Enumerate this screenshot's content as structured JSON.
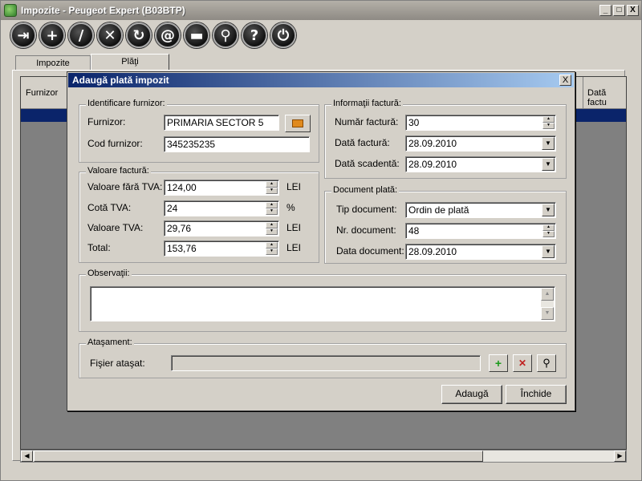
{
  "window": {
    "title": "Impozite - Peugeot Expert (B03BTP)",
    "min": "_",
    "max": "□",
    "close": "X"
  },
  "toolbar": [
    {
      "icon": "exit-icon",
      "glyph": "⇥"
    },
    {
      "icon": "add-icon",
      "glyph": "+"
    },
    {
      "icon": "edit-icon",
      "glyph": "/"
    },
    {
      "icon": "delete-icon",
      "glyph": "✕"
    },
    {
      "icon": "refresh-icon",
      "glyph": "↻"
    },
    {
      "icon": "email-icon",
      "glyph": "@"
    },
    {
      "icon": "print-icon",
      "glyph": "▬"
    },
    {
      "icon": "search-icon",
      "glyph": "⚲"
    },
    {
      "icon": "help-icon",
      "glyph": "?"
    },
    {
      "icon": "power-icon",
      "glyph": "⏻"
    }
  ],
  "tabs": [
    "Impozite",
    "Plăţi"
  ],
  "grid": {
    "col_left": "Furnizor",
    "col_right": "Dată factu"
  },
  "dialog": {
    "title": "Adaugă plată impozit",
    "close": "X",
    "identificare": {
      "title": "Identificare furnizor:",
      "furnizor_label": "Furnizor:",
      "furnizor_value": "PRIMARIA SECTOR 5",
      "cod_label": "Cod furnizor:",
      "cod_value": "345235235"
    },
    "valoare": {
      "title": "Valoare factură:",
      "fara_tva_label": "Valoare fără TVA:",
      "fara_tva_value": "124,00",
      "fara_tva_unit": "LEI",
      "cota_label": "Cotă TVA:",
      "cota_value": "24",
      "cota_unit": "%",
      "tva_label": "Valoare TVA:",
      "tva_value": "29,76",
      "tva_unit": "LEI",
      "total_label": "Total:",
      "total_value": "153,76",
      "total_unit": "LEI"
    },
    "informatii": {
      "title": "Informaţii factură:",
      "numar_label": "Număr factură:",
      "numar_value": "30",
      "data_label": "Dată factură:",
      "data_value": "28.09.2010",
      "scadenta_label": "Dată scadentă:",
      "scadenta_value": "28.09.2010"
    },
    "document": {
      "title": "Document plată:",
      "tip_label": "Tip document:",
      "tip_value": "Ordin de plată",
      "nr_label": "Nr. document:",
      "nr_value": "48",
      "data_label": "Data document:",
      "data_value": "28.09.2010"
    },
    "observatii": {
      "title": "Observaţii:",
      "value": ""
    },
    "atasament": {
      "title": "Ataşament:",
      "fisier_label": "Fişier ataşat:",
      "fisier_value": ""
    },
    "buttons": {
      "add": "Adaugă",
      "close": "Închide"
    }
  },
  "colors": {
    "titlebar_active": "#0a246a",
    "face": "#d4d0c8",
    "grid_bg": "#808080"
  }
}
